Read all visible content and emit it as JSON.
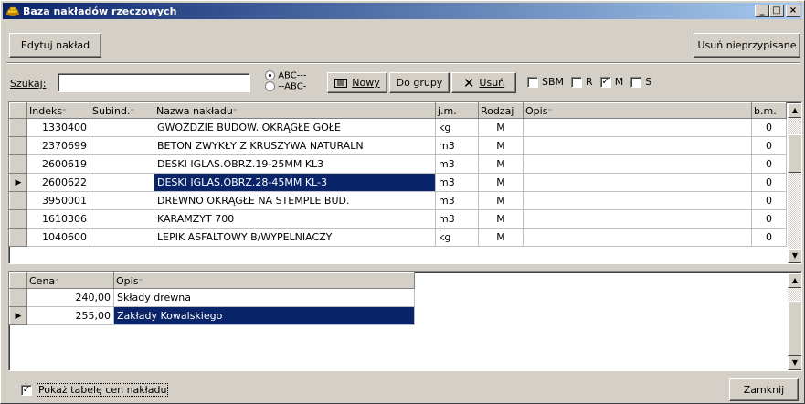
{
  "window": {
    "title": "Baza nakładów rzeczowych",
    "minimize": "_",
    "maximize": "□",
    "close": "×"
  },
  "toolbar": {
    "edit_label": "Edytuj nakład",
    "remove_unassigned_label": "Usuń nieprzypisane"
  },
  "search": {
    "label": "Szukaj:",
    "value": "",
    "sort_asc": "ABC---",
    "sort_desc": "--ABC-",
    "new_label": "Nowy",
    "to_group_label": "Do grupy",
    "delete_label": "Usuń",
    "filters": [
      {
        "label": "SBM",
        "checked": false
      },
      {
        "label": "R",
        "checked": false
      },
      {
        "label": "M",
        "checked": true
      },
      {
        "label": "S",
        "checked": false
      }
    ]
  },
  "main_table": {
    "columns": [
      "Indeks",
      "Subind.",
      "Nazwa nakładu",
      "j.m.",
      "Rodzaj",
      "Opis",
      "b.m."
    ],
    "rows": [
      {
        "indeks": "1330400",
        "subind": "",
        "nazwa": "GWOŹDZIE BUDOW. OKRĄGŁE GOŁE",
        "jm": "kg",
        "rodzaj": "M",
        "opis": "",
        "bm": "0",
        "selected": false
      },
      {
        "indeks": "2370699",
        "subind": "",
        "nazwa": "BETON ZWYKŁY Z KRUSZYWA NATURALN",
        "jm": "m3",
        "rodzaj": "M",
        "opis": "",
        "bm": "0",
        "selected": false
      },
      {
        "indeks": "2600619",
        "subind": "",
        "nazwa": "DESKI IGLAS.OBRZ.19-25MM KL3",
        "jm": "m3",
        "rodzaj": "M",
        "opis": "",
        "bm": "0",
        "selected": false
      },
      {
        "indeks": "2600622",
        "subind": "",
        "nazwa": "DESKI IGLAS.OBRZ.28-45MM KL-3",
        "jm": "m3",
        "rodzaj": "M",
        "opis": "",
        "bm": "0",
        "selected": true
      },
      {
        "indeks": "3950001",
        "subind": "",
        "nazwa": "DREWNO OKRĄGŁE NA STEMPLE BUD.",
        "jm": "m3",
        "rodzaj": "M",
        "opis": "",
        "bm": "0",
        "selected": false
      },
      {
        "indeks": "1610306",
        "subind": "",
        "nazwa": "KARAMZYT 700",
        "jm": "m3",
        "rodzaj": "M",
        "opis": "",
        "bm": "0",
        "selected": false
      },
      {
        "indeks": "1040600",
        "subind": "",
        "nazwa": "LEPIK ASFALTOWY B/WYPELNIACZY",
        "jm": "kg",
        "rodzaj": "M",
        "opis": "",
        "bm": "0",
        "selected": false
      }
    ]
  },
  "price_table": {
    "columns": [
      "Cena",
      "Opis"
    ],
    "rows": [
      {
        "cena": "240,00",
        "opis": "Składy drewna",
        "selected": false
      },
      {
        "cena": "255,00",
        "opis": "Zakłady Kowalskiego",
        "selected": true
      }
    ]
  },
  "footer": {
    "show_prices_label": "Pokaż tabelę cen nakładu",
    "show_prices_checked": true,
    "close_label": "Zamknij"
  },
  "colors": {
    "selection": "#0a246a",
    "face": "#d4d0c8"
  }
}
